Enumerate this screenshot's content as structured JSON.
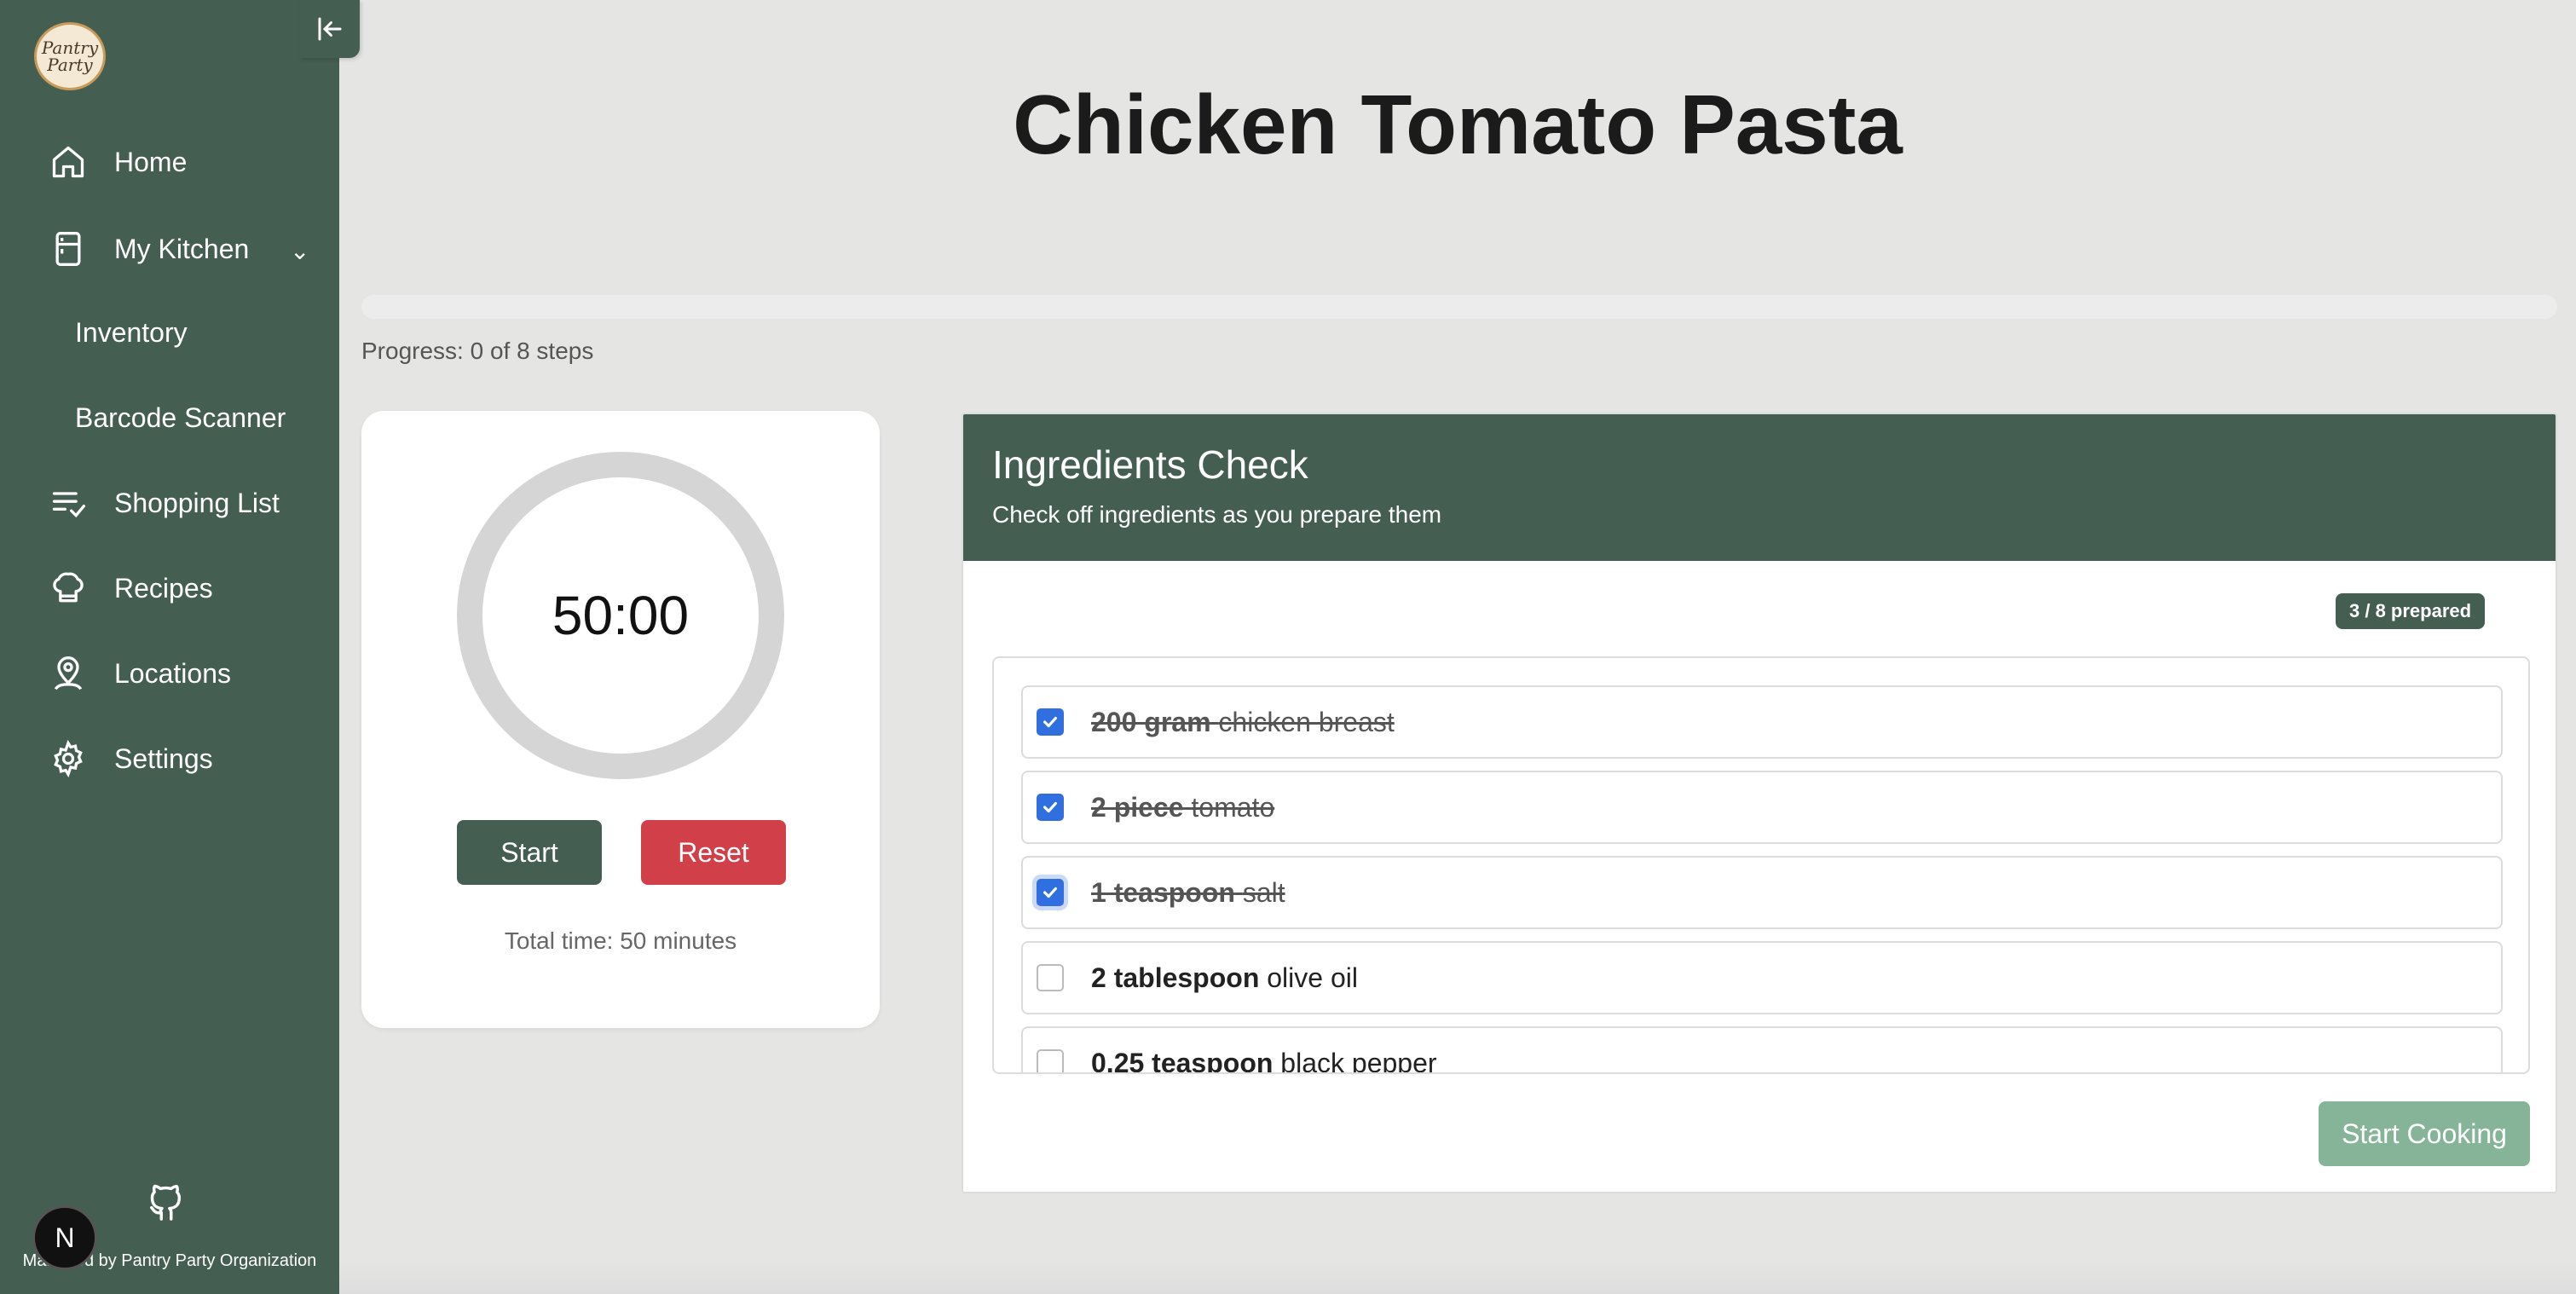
{
  "sidebar": {
    "logo_text": "Pantry Party",
    "nav": {
      "home": "Home",
      "my_kitchen": "My Kitchen",
      "inventory": "Inventory",
      "barcode_scanner": "Barcode Scanner",
      "shopping_list": "Shopping List",
      "recipes": "Recipes",
      "locations": "Locations",
      "settings": "Settings"
    },
    "footer": "Managed by Pantry Party Organization",
    "badge": "N"
  },
  "recipe": {
    "title": "Chicken Tomato Pasta",
    "progress_text": "Progress: 0 of 8 steps",
    "progress_fraction": 0
  },
  "timer": {
    "display": "50:00",
    "start_label": "Start",
    "reset_label": "Reset",
    "total_time": "Total time: 50 minutes"
  },
  "ingredients": {
    "title": "Ingredients Check",
    "subtitle": "Check off ingredients as you prepare them",
    "prepared_badge": "3 / 8 prepared",
    "items": [
      {
        "qty": "200 gram",
        "name": "chicken breast",
        "checked": true
      },
      {
        "qty": "2 piece",
        "name": "tomato",
        "checked": true
      },
      {
        "qty": "1 teaspoon",
        "name": "salt",
        "checked": true
      },
      {
        "qty": "2 tablespoon",
        "name": "olive oil",
        "checked": false
      },
      {
        "qty": "0.25 teaspoon",
        "name": "black pepper",
        "checked": false
      }
    ],
    "start_cooking_label": "Start Cooking"
  },
  "colors": {
    "sidebar": "#445e51",
    "checkbox": "#2f6fe0",
    "reset": "#d13f48",
    "start_cooking": "#86b498"
  }
}
